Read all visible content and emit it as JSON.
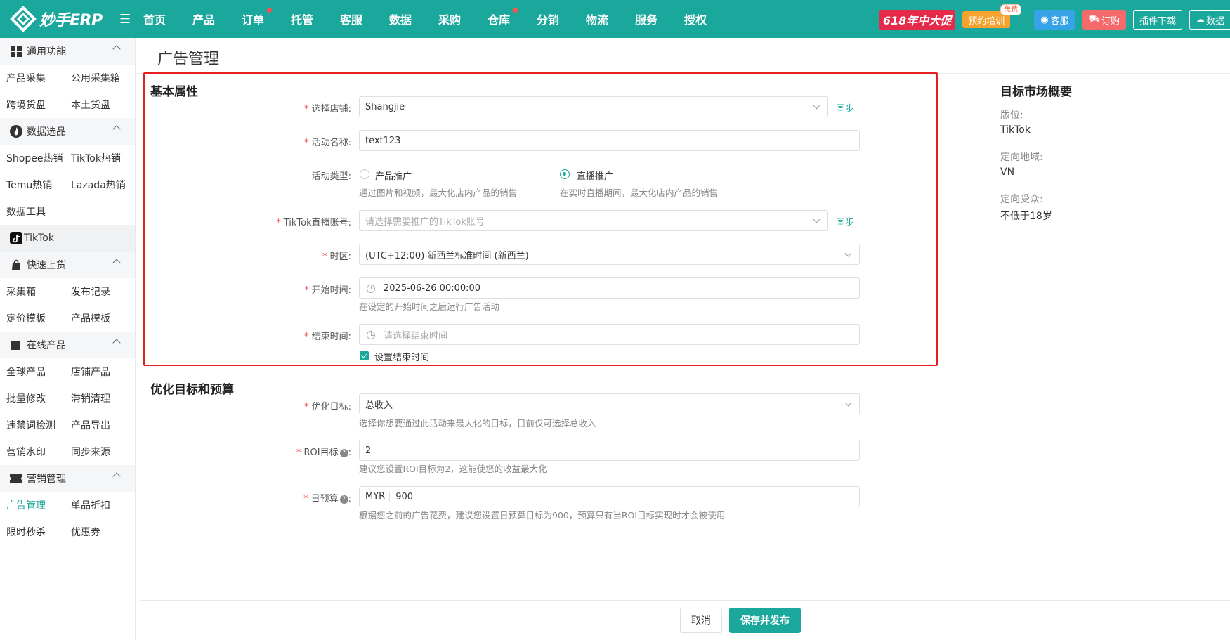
{
  "header": {
    "logo_text": "妙手ERP",
    "nav": [
      "首页",
      "产品",
      "订单",
      "托管",
      "客服",
      "数据",
      "采购",
      "仓库",
      "分销",
      "物流",
      "服务",
      "授权"
    ],
    "promo": "618年中大促",
    "training": "预约培训",
    "training_badge": "免费",
    "service": "客服",
    "order": "订购",
    "plugin": "插件下载",
    "data": "数据"
  },
  "sidebar": {
    "groups": [
      {
        "title": "通用功能",
        "rows": [
          [
            "产品采集",
            "公用采集箱"
          ],
          [
            "跨境货盘",
            "本土货盘"
          ]
        ]
      },
      {
        "title": "数据选品",
        "rows": [
          [
            "Shopee热销",
            "TikTok热销"
          ],
          [
            "Temu热销",
            "Lazada热销"
          ],
          [
            "数据工具",
            ""
          ]
        ]
      },
      {
        "title": "快速上货",
        "rows": [
          [
            "采集箱",
            "发布记录"
          ],
          [
            "定价模板",
            "产品模板"
          ]
        ]
      },
      {
        "title": "在线产品",
        "rows": [
          [
            "全球产品",
            "店铺产品"
          ],
          [
            "批量修改",
            "滞销清理"
          ],
          [
            "违禁词检测",
            "产品导出"
          ],
          [
            "营销水印",
            "同步来源"
          ]
        ]
      },
      {
        "title": "营销管理",
        "rows": [
          [
            "广告管理",
            "单品折扣"
          ],
          [
            "限时秒杀",
            "优惠券"
          ]
        ]
      }
    ],
    "tiktok": "TikTok"
  },
  "page": {
    "title": "广告管理",
    "basic": {
      "title": "基本属性",
      "store_label": "选择店铺:",
      "store_value": "Shangjie",
      "sync": "同步",
      "name_label": "活动名称:",
      "name_value": "text123",
      "type_label": "活动类型:",
      "type_opt1": "产品推广",
      "type_opt1_hint": "通过图片和视频，最大化店内产品的销售",
      "type_opt2": "直播推广",
      "type_opt2_hint": "在实时直播期间，最大化店内产品的销售",
      "account_label": "TikTok直播账号:",
      "account_placeholder": "请选择需要推广的TikTok账号",
      "tz_label": "时区:",
      "tz_value": "(UTC+12:00) 新西兰标准时间 (新西兰)",
      "start_label": "开始时间:",
      "start_value": "2025-06-26 00:00:00",
      "start_hint": "在设定的开始时间之后运行广告活动",
      "end_label": "结束时间:",
      "end_placeholder": "请选择结束时间",
      "end_check": "设置结束时间"
    },
    "optim": {
      "title": "优化目标和预算",
      "goal_label": "优化目标:",
      "goal_value": "总收入",
      "goal_hint": "选择你想要通过此活动来最大化的目标，目前仅可选择总收入",
      "roi_label": "ROI目标",
      "roi_value": "2",
      "roi_hint": "建议您设置ROI目标为2，这能使您的收益最大化",
      "budget_label": "日预算",
      "budget_currency": "MYR",
      "budget_value": "900",
      "budget_hint": "根据您之前的广告花费，建议您设置日预算目标为900，预算只有当ROI目标实现时才会被使用"
    },
    "market": {
      "title": "目标市场概要",
      "placement_label": "版位:",
      "placement_value": "TikTok",
      "region_label": "定向地域:",
      "region_value": "VN",
      "audience_label": "定向受众:",
      "audience_value": "不低于18岁"
    },
    "footer": {
      "cancel": "取消",
      "save": "保存并发布"
    }
  },
  "colors": {
    "brand": "#1aa79c",
    "highlight": "#e61e1e"
  }
}
